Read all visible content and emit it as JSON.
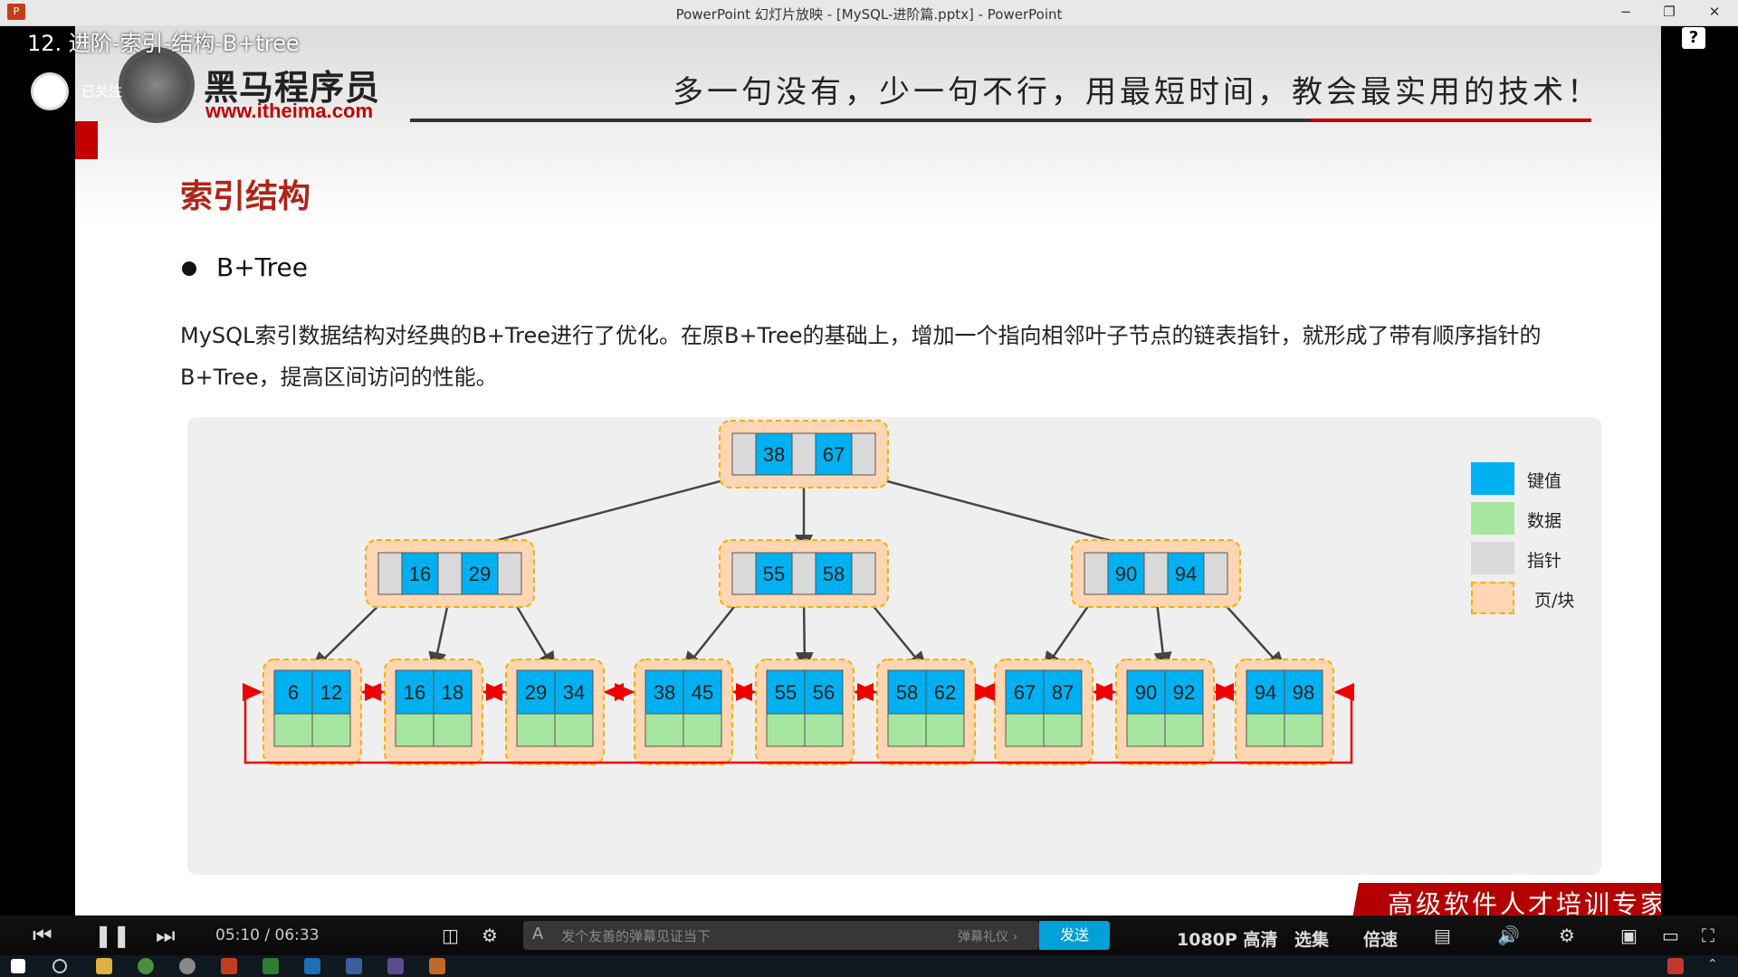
{
  "window": {
    "title": "PowerPoint 幻灯片放映 - [MySQL-进阶篇.pptx] - PowerPoint",
    "app_icon": "P",
    "minimize": "−",
    "maximize": "❐",
    "close": "✕"
  },
  "video": {
    "title": "12. 进阶-索引-结构-B+tree",
    "follow_label": "已关注",
    "help": "?"
  },
  "slide": {
    "logo_cn": "黑马程序员",
    "logo_url": "www.itheima.com",
    "slogan": "多一句没有，少一句不行，用最短时间，教会最实用的技术！",
    "section_title": "索引结构",
    "bullet": "B+Tree",
    "paragraph": "MySQL索引数据结构对经典的B+Tree进行了优化。在原B+Tree的基础上，增加一个指向相邻叶子节点的链表指针，就形成了带有顺序指针的B+Tree，提高区间访问的性能。",
    "bottom_banner": "高级软件人才培训专家",
    "tree": {
      "root": [
        "38",
        "67"
      ],
      "internal": [
        [
          "16",
          "29"
        ],
        [
          "55",
          "58"
        ],
        [
          "90",
          "94"
        ]
      ],
      "leaves": [
        [
          "6",
          "12"
        ],
        [
          "16",
          "18"
        ],
        [
          "29",
          "34"
        ],
        [
          "38",
          "45"
        ],
        [
          "55",
          "56"
        ],
        [
          "58",
          "62"
        ],
        [
          "67",
          "87"
        ],
        [
          "90",
          "92"
        ],
        [
          "94",
          "98"
        ]
      ]
    },
    "legend": [
      {
        "label": "键值",
        "color": "#00b0f0"
      },
      {
        "label": "数据",
        "color": "#a6e6a0"
      },
      {
        "label": "指针",
        "color": "#d9d9d9"
      },
      {
        "label": "页/块",
        "color": "#ffd6b3"
      }
    ]
  },
  "player": {
    "time_current": "05:10",
    "time_sep": "/",
    "time_total": "06:33",
    "danmu_placeholder": "发个友善的弹幕见证当下",
    "etiquette": "弹幕礼仪 ›",
    "send": "发送",
    "quality": "1080P 高清",
    "episodes": "选集",
    "speed": "倍速"
  }
}
